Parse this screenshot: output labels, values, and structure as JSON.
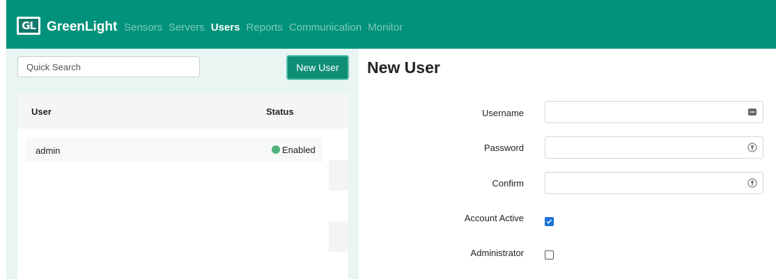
{
  "header": {
    "logo_text": "GL",
    "brand": "GreenLight",
    "nav": [
      {
        "label": "Sensors",
        "active": false
      },
      {
        "label": "Servers",
        "active": false
      },
      {
        "label": "Users",
        "active": true
      },
      {
        "label": "Reports",
        "active": false
      },
      {
        "label": "Communication",
        "active": false
      },
      {
        "label": "Monitor",
        "active": false
      }
    ]
  },
  "users_panel": {
    "search_placeholder": "Quick Search",
    "new_user_button": "New User",
    "columns": [
      "User",
      "Status"
    ],
    "rows": [
      {
        "user": "admin",
        "status": "Enabled",
        "status_color": "#4fb37c"
      }
    ]
  },
  "form": {
    "title": "New User",
    "fields": {
      "username": {
        "label": "Username",
        "value": "",
        "icon": "more-dots-icon"
      },
      "password": {
        "label": "Password",
        "value": "",
        "icon": "key-icon"
      },
      "confirm": {
        "label": "Confirm",
        "value": "",
        "icon": "key-icon"
      }
    },
    "checkboxes": {
      "account_active": {
        "label": "Account Active",
        "checked": true
      },
      "administrator": {
        "label": "Administrator",
        "checked": false
      }
    }
  },
  "colors": {
    "brand_green": "#00927a",
    "button_green": "#0f8e76",
    "nav_inactive": "#7fc9bb",
    "checkbox_blue": "#1a73d6"
  }
}
